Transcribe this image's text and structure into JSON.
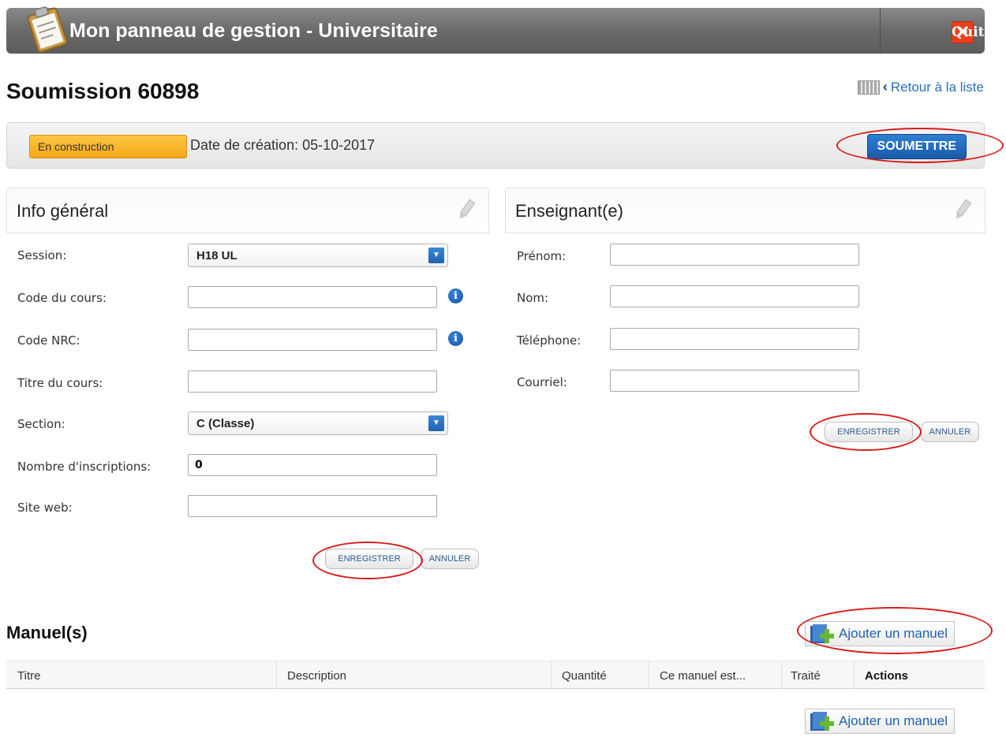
{
  "header": {
    "title": "Mon panneau de gestion - Universitaire",
    "quit_label": "Quitter",
    "quit_icon": "close-icon"
  },
  "page": {
    "title": "Soumission 60898",
    "back_label": "Retour à la liste"
  },
  "status": {
    "badge": "En construction",
    "created": "Date de création: 05-10-2017",
    "submit_label": "SOUMETTRE"
  },
  "info": {
    "heading": "Info général",
    "session_label": "Session:",
    "session_value": "H18 UL",
    "course_code_label": "Code du cours:",
    "course_code_value": "",
    "nrc_label": "Code NRC:",
    "nrc_value": "",
    "course_title_label": "Titre du cours:",
    "course_title_value": "",
    "section_label": "Section:",
    "section_value": "C (Classe)",
    "enrolments_label": "Nombre d'inscriptions:",
    "enrolments_value": "0",
    "website_label": "Site web:",
    "website_value": "",
    "save_label": "ENREGISTRER",
    "cancel_label": "ANNULER"
  },
  "teacher": {
    "heading": "Enseignant(e)",
    "firstname_label": "Prénom:",
    "lastname_label": "Nom:",
    "phone_label": "Téléphone:",
    "email_label": "Courriel:",
    "save_label": "ENREGISTRER",
    "cancel_label": "ANNULER"
  },
  "manuals": {
    "heading": "Manuel(s)",
    "add_label": "Ajouter un manuel",
    "columns": [
      "Titre",
      "Description",
      "Quantité",
      "Ce manuel est...",
      "Traité",
      "Actions"
    ]
  },
  "colors": {
    "accent": "#1a5aa8",
    "status_badge": "#f5a81a",
    "quit": "#e8401c",
    "annotation": "#d91a1a"
  }
}
